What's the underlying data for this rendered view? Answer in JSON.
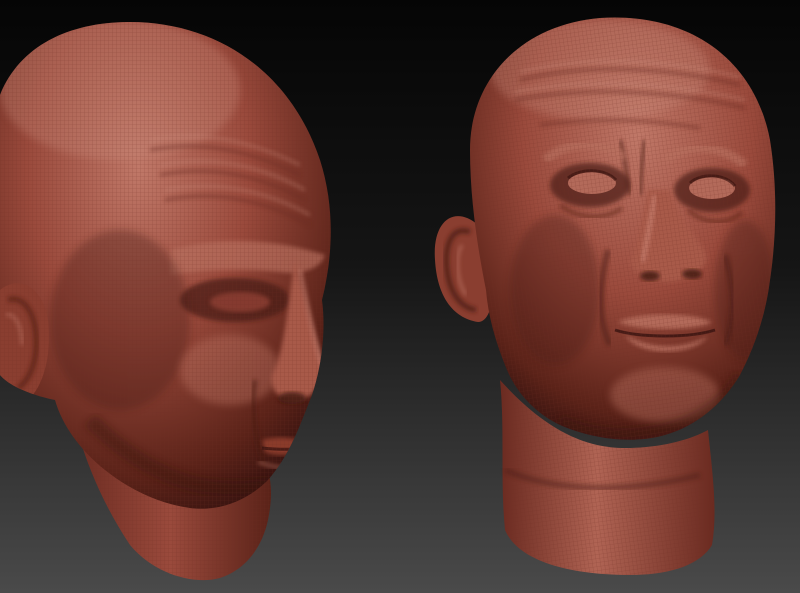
{
  "scene": {
    "background_top": "#050505",
    "background_bottom": "#4a4a4a",
    "clay_light": "#c07868",
    "clay_base": "#9a4a3c",
    "clay_dark": "#5a2218",
    "clay_shadow": "#3a1410",
    "wireframe_color": "#6e2c22",
    "heads": [
      {
        "label": "",
        "view": "three-quarter-left"
      },
      {
        "label": "",
        "view": "front-three-quarter"
      }
    ]
  }
}
